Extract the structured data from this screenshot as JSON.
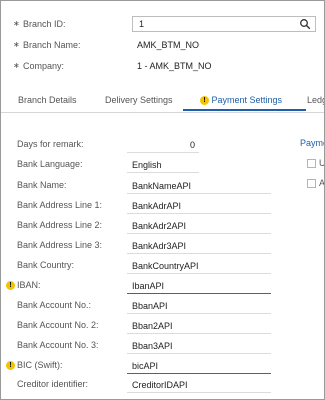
{
  "header": {
    "branch_id_label": "Branch ID:",
    "branch_id_value": "1",
    "branch_name_label": "Branch Name:",
    "branch_name_value": "AMK_BTM_NO",
    "company_label": "Company:",
    "company_value": "1 - AMK_BTM_NO"
  },
  "tabs": [
    {
      "label": "Branch Details",
      "active": false
    },
    {
      "label": "Delivery Settings",
      "active": false
    },
    {
      "label": "Payment Settings",
      "active": true,
      "warning": true
    },
    {
      "label": "Ledg",
      "active": false
    }
  ],
  "fields": [
    {
      "label": "Days for remark:",
      "value": "0"
    },
    {
      "label": "Bank Language:",
      "value": "English"
    },
    {
      "label": "Bank Name:",
      "value": "BankNameAPI"
    },
    {
      "label": "Bank Address Line 1:",
      "value": "BankAdrAPI"
    },
    {
      "label": "Bank Address Line 2:",
      "value": "BankAdr2API"
    },
    {
      "label": "Bank Address Line 3:",
      "value": "BankAdr3API"
    },
    {
      "label": "Bank Country:",
      "value": "BankCountryAPI"
    },
    {
      "label": "IBAN:",
      "value": "IbanAPI",
      "warning": true
    },
    {
      "label": "Bank Account No.:",
      "value": "BbanAPI"
    },
    {
      "label": "Bank Account No. 2:",
      "value": "Bban2API"
    },
    {
      "label": "Bank Account No. 3:",
      "value": "Bban3API"
    },
    {
      "label": "BIC (Swift):",
      "value": "bicAPI",
      "warning": true
    },
    {
      "label": "Creditor identifier:",
      "value": "CreditorIDAPI"
    }
  ],
  "right_panel": {
    "link_text": "Payme",
    "option1": "U",
    "option2": "A"
  },
  "colors": {
    "accent": "#1d5fa8",
    "warning": "#f2c500",
    "error": "#c0392b"
  }
}
